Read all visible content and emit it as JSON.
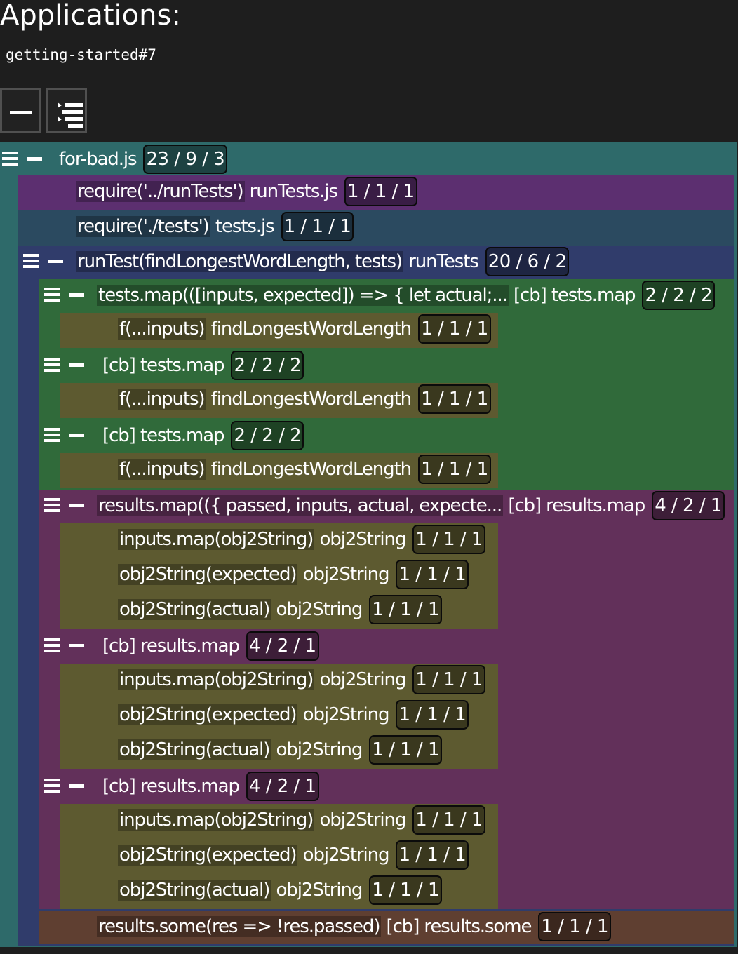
{
  "header": {
    "title": "Applications:",
    "app_name": "getting-started#7"
  },
  "toolbar": {
    "collapse_all_icon": "minus-icon",
    "expand_all_icon": "tree-list-icon"
  },
  "colors": {
    "teal": "#2e6a6a",
    "purple": "#5c2f70",
    "slate": "#2b4a60",
    "navy": "#303c6b",
    "green": "#306a3a",
    "olive": "#5d5a30",
    "plum": "#62305a",
    "brown": "#5f3f31"
  },
  "tree": {
    "n0": {
      "code": "",
      "name": "for-bad.js",
      "stats": "23 / 9 / 3"
    },
    "n1": {
      "code": "require('../runTests')",
      "name": "runTests.js",
      "stats": "1 / 1 / 1"
    },
    "n2": {
      "code": "require('./tests')",
      "name": "tests.js",
      "stats": "1 / 1 / 1"
    },
    "n3": {
      "code": "runTest(findLongestWordLength, tests)",
      "name": "runTests",
      "stats": "20 / 6 / 2"
    },
    "n4": {
      "code": "tests.map(([inputs, expected]) => { let actual;...",
      "name": "[cb] tests.map",
      "stats": "2 / 2 / 2"
    },
    "n5": {
      "code": "f(...inputs)",
      "name": "findLongestWordLength",
      "stats": "1 / 1 / 1"
    },
    "n6": {
      "code": "",
      "name": "[cb] tests.map",
      "stats": "2 / 2 / 2"
    },
    "n7": {
      "code": "f(...inputs)",
      "name": "findLongestWordLength",
      "stats": "1 / 1 / 1"
    },
    "n8": {
      "code": "",
      "name": "[cb] tests.map",
      "stats": "2 / 2 / 2"
    },
    "n9": {
      "code": "f(...inputs)",
      "name": "findLongestWordLength",
      "stats": "1 / 1 / 1"
    },
    "n10": {
      "code": "results.map(({ passed, inputs, actual, expecte...",
      "name": "[cb] results.map",
      "stats": "4 / 2 / 1"
    },
    "n11": {
      "code": "inputs.map(obj2String)",
      "name": "obj2String",
      "stats": "1 / 1 / 1"
    },
    "n12": {
      "code": "obj2String(expected)",
      "name": "obj2String",
      "stats": "1 / 1 / 1"
    },
    "n13": {
      "code": "obj2String(actual)",
      "name": "obj2String",
      "stats": "1 / 1 / 1"
    },
    "n14": {
      "code": "",
      "name": "[cb] results.map",
      "stats": "4 / 2 / 1"
    },
    "n15": {
      "code": "inputs.map(obj2String)",
      "name": "obj2String",
      "stats": "1 / 1 / 1"
    },
    "n16": {
      "code": "obj2String(expected)",
      "name": "obj2String",
      "stats": "1 / 1 / 1"
    },
    "n17": {
      "code": "obj2String(actual)",
      "name": "obj2String",
      "stats": "1 / 1 / 1"
    },
    "n18": {
      "code": "",
      "name": "[cb] results.map",
      "stats": "4 / 2 / 1"
    },
    "n19": {
      "code": "inputs.map(obj2String)",
      "name": "obj2String",
      "stats": "1 / 1 / 1"
    },
    "n20": {
      "code": "obj2String(expected)",
      "name": "obj2String",
      "stats": "1 / 1 / 1"
    },
    "n21": {
      "code": "obj2String(actual)",
      "name": "obj2String",
      "stats": "1 / 1 / 1"
    },
    "n22": {
      "code": "results.some(res => !res.passed)",
      "name": "[cb] results.some",
      "stats": "1 / 1 / 1"
    }
  }
}
